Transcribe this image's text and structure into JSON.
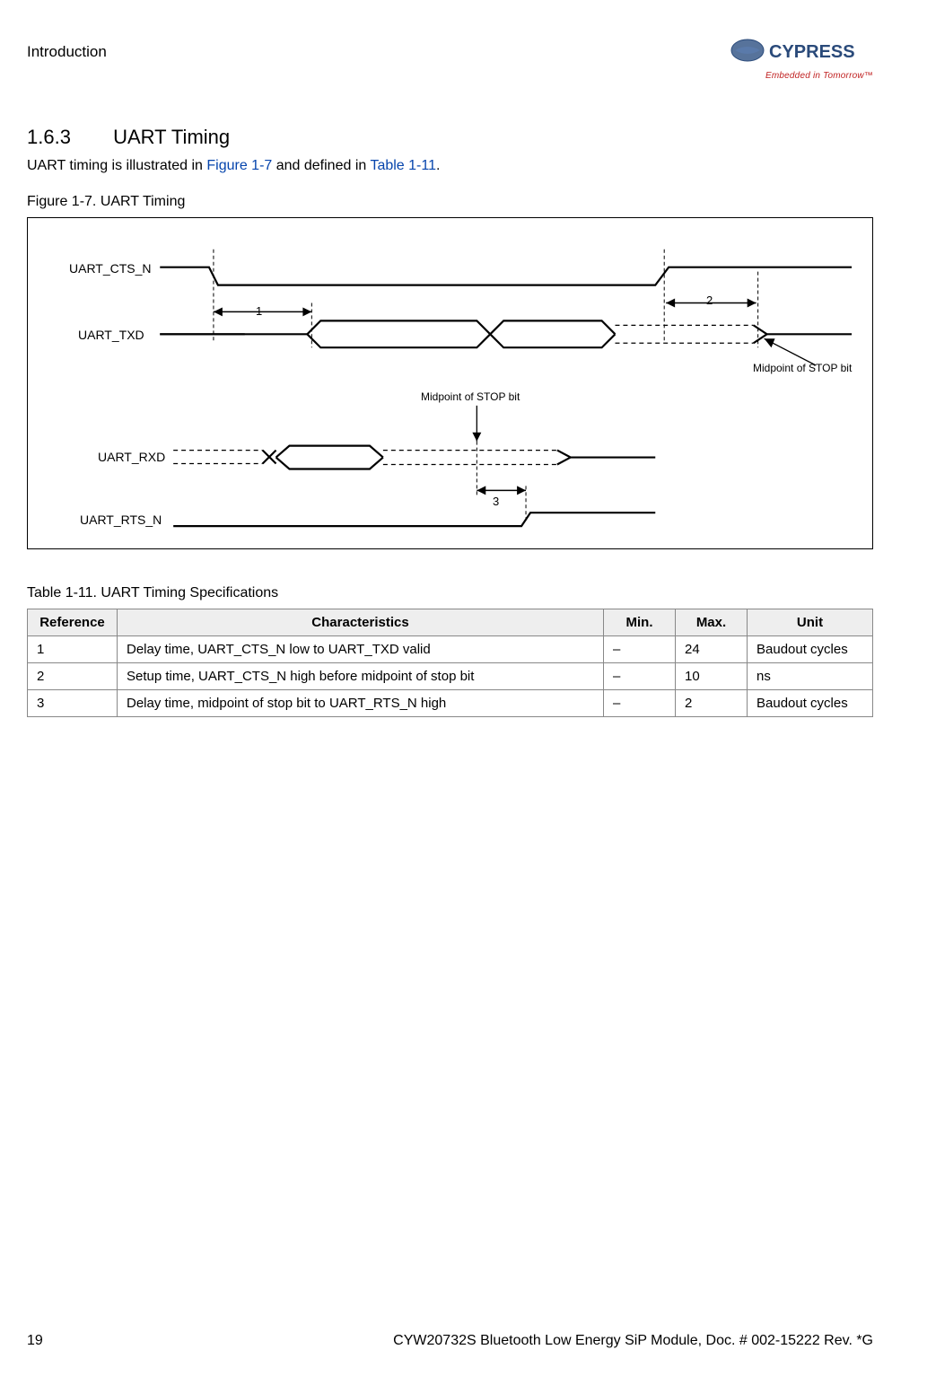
{
  "header": {
    "section_label": "Introduction",
    "logo_text": "CYPRESS",
    "tagline": "Embedded in Tomorrow™"
  },
  "section": {
    "number": "1.6.3",
    "title": "UART Timing"
  },
  "intro": {
    "prefix": "UART timing is illustrated in ",
    "ref1": "Figure 1-7",
    "mid": " and defined in ",
    "ref2": "Table 1-11",
    "suffix": "."
  },
  "figure": {
    "caption": "Figure 1-7.  UART Timing",
    "signals": {
      "cts": "UART_CTS_N",
      "txd": "UART_TXD",
      "rxd": "UART_RXD",
      "rts": "UART_RTS_N"
    },
    "annotations": {
      "midpoint_top": "Midpoint of STOP bit",
      "midpoint_bottom": "Midpoint of STOP bit"
    },
    "dims": {
      "d1": "1",
      "d2": "2",
      "d3": "3"
    }
  },
  "table": {
    "caption": "Table 1-11.  UART Timing Specifications",
    "headers": {
      "ref": "Reference",
      "char": "Characteristics",
      "min": "Min.",
      "max": "Max.",
      "unit": "Unit"
    },
    "rows": [
      {
        "ref": "1",
        "char": "Delay time, UART_CTS_N low to UART_TXD valid",
        "min": "–",
        "max": "24",
        "unit": "Baudout cycles"
      },
      {
        "ref": "2",
        "char": "Setup time, UART_CTS_N high before midpoint of stop bit",
        "min": "–",
        "max": "10",
        "unit": "ns"
      },
      {
        "ref": "3",
        "char": "Delay time, midpoint of stop bit to UART_RTS_N high",
        "min": "–",
        "max": "2",
        "unit": "Baudout cycles"
      }
    ]
  },
  "footer": {
    "page": "19",
    "docref": "CYW20732S Bluetooth Low Energy SiP Module, Doc. # 002-15222 Rev. *G"
  },
  "chart_data": {
    "type": "table",
    "title": "UART Timing Specifications",
    "columns": [
      "Reference",
      "Characteristics",
      "Min.",
      "Max.",
      "Unit"
    ],
    "rows": [
      [
        "1",
        "Delay time, UART_CTS_N low to UART_TXD valid",
        "–",
        "24",
        "Baudout cycles"
      ],
      [
        "2",
        "Setup time, UART_CTS_N high before midpoint of stop bit",
        "–",
        "10",
        "ns"
      ],
      [
        "3",
        "Delay time, midpoint of stop bit to UART_RTS_N high",
        "–",
        "2",
        "Baudout cycles"
      ]
    ]
  }
}
